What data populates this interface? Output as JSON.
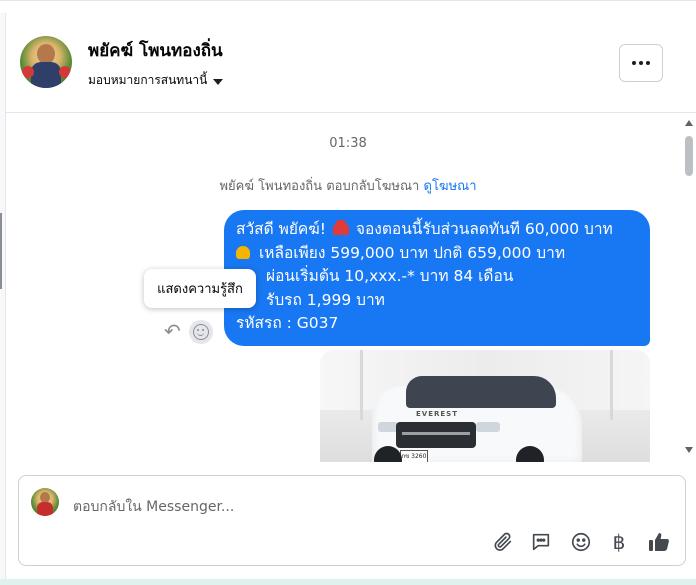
{
  "header": {
    "contact_name": "พยัคฆ์ โพนทองถิ่น",
    "assign_label": "มอบหมายการสนทนานี้"
  },
  "chat": {
    "timestamp": "01:38",
    "reply_note_prefix": "พยัคฆ์ โพนทองถิ่น ตอบกลับโฆษณา",
    "reply_note_link": "ดูโฆษณา",
    "message_lines": [
      "สวัสดี พยัคฆ์! ",
      " จองตอนนี้รับส่วนลดทันที 60,000 บาท",
      " เหลือเพียง 599,000 บาท ปกติ 659,000 บาท",
      "ผ่อนเริ่มต้น 10,xxx.-* บาท 84 เดือน",
      "รับรถ 1,999 บาท",
      "รหัสรถ : G037"
    ],
    "tooltip": "แสดงความรู้สึก",
    "car_brand_text": "EVEREST",
    "plate_text": "กข 3260"
  },
  "composer": {
    "placeholder": "ตอบกลับใน Messenger...",
    "baht_symbol": "฿"
  },
  "icons": {
    "more": "more-horizontal-icon",
    "caret": "caret-down-icon",
    "reply": "reply-icon",
    "react": "smiley-reaction-icon",
    "attach": "paperclip-icon",
    "saved_replies": "chat-bubble-icon",
    "emoji": "emoji-icon",
    "payment": "baht-icon",
    "like": "thumbs-up-icon"
  },
  "colors": {
    "bubble": "#1877f2",
    "link": "#1877f2",
    "muted_text": "#65676b"
  }
}
